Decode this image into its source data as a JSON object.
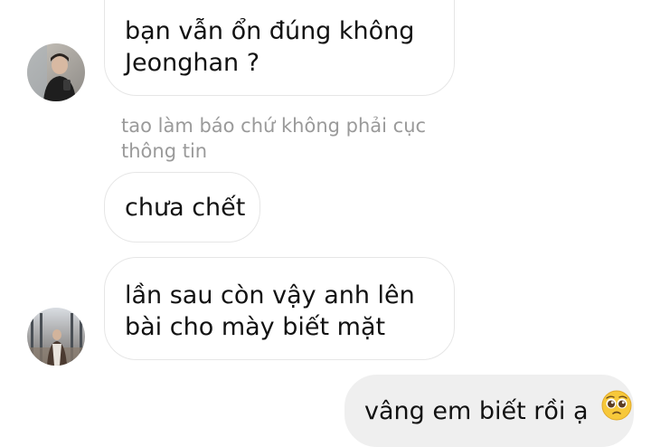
{
  "messages": [
    {
      "sender": "other",
      "lines": [
        "bạn vẫn ổn đúng không",
        "Jeonghan ?"
      ]
    },
    {
      "sender": "other",
      "reply_context": [
        "tao làm báo chứ không phải cục",
        "thông tin"
      ],
      "text": "chưa chết"
    },
    {
      "sender": "other",
      "lines": [
        "lần sau còn vậy anh lên",
        "bài cho mày biết mặt"
      ]
    },
    {
      "sender": "me",
      "text": "vâng em biết rồi ạ",
      "emoji": "pleading-face"
    }
  ],
  "colors": {
    "background": "#ffffff",
    "incoming_bubble_border": "#e6e6e6",
    "outgoing_bubble": "#efefef",
    "text": "#121212",
    "reply_context_text": "#9a9a9a"
  }
}
